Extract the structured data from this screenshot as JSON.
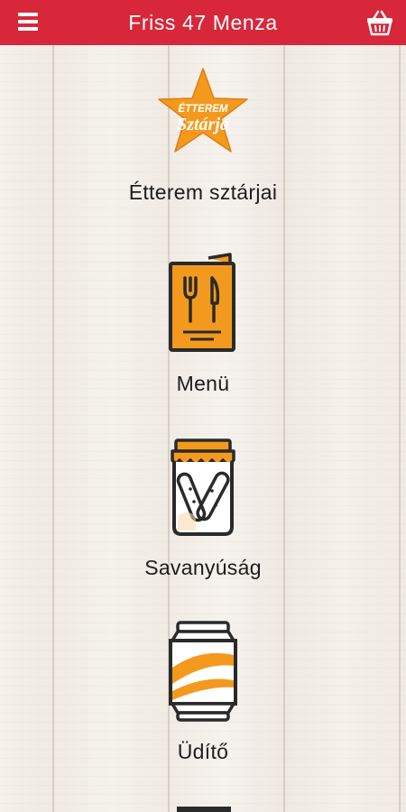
{
  "header": {
    "title": "Friss 47 Menza",
    "menu_icon": "hamburger-menu-icon",
    "cart_icon": "shopping-basket-icon"
  },
  "menu": {
    "items": [
      {
        "label": "Étterem sztárjai",
        "icon": "restaurant-stars-star-icon",
        "badge_line1": "ÉTTEREM",
        "badge_line2": "Sztárja"
      },
      {
        "label": "Menü",
        "icon": "menu-card-cutlery-icon"
      },
      {
        "label": "Savanyúság",
        "icon": "pickle-jar-icon"
      },
      {
        "label": "Üdítő",
        "icon": "soda-can-icon"
      }
    ]
  },
  "colors": {
    "header_red": "#d8273a",
    "accent_orange": "#f39a1e",
    "outline": "#2a2a2a"
  }
}
